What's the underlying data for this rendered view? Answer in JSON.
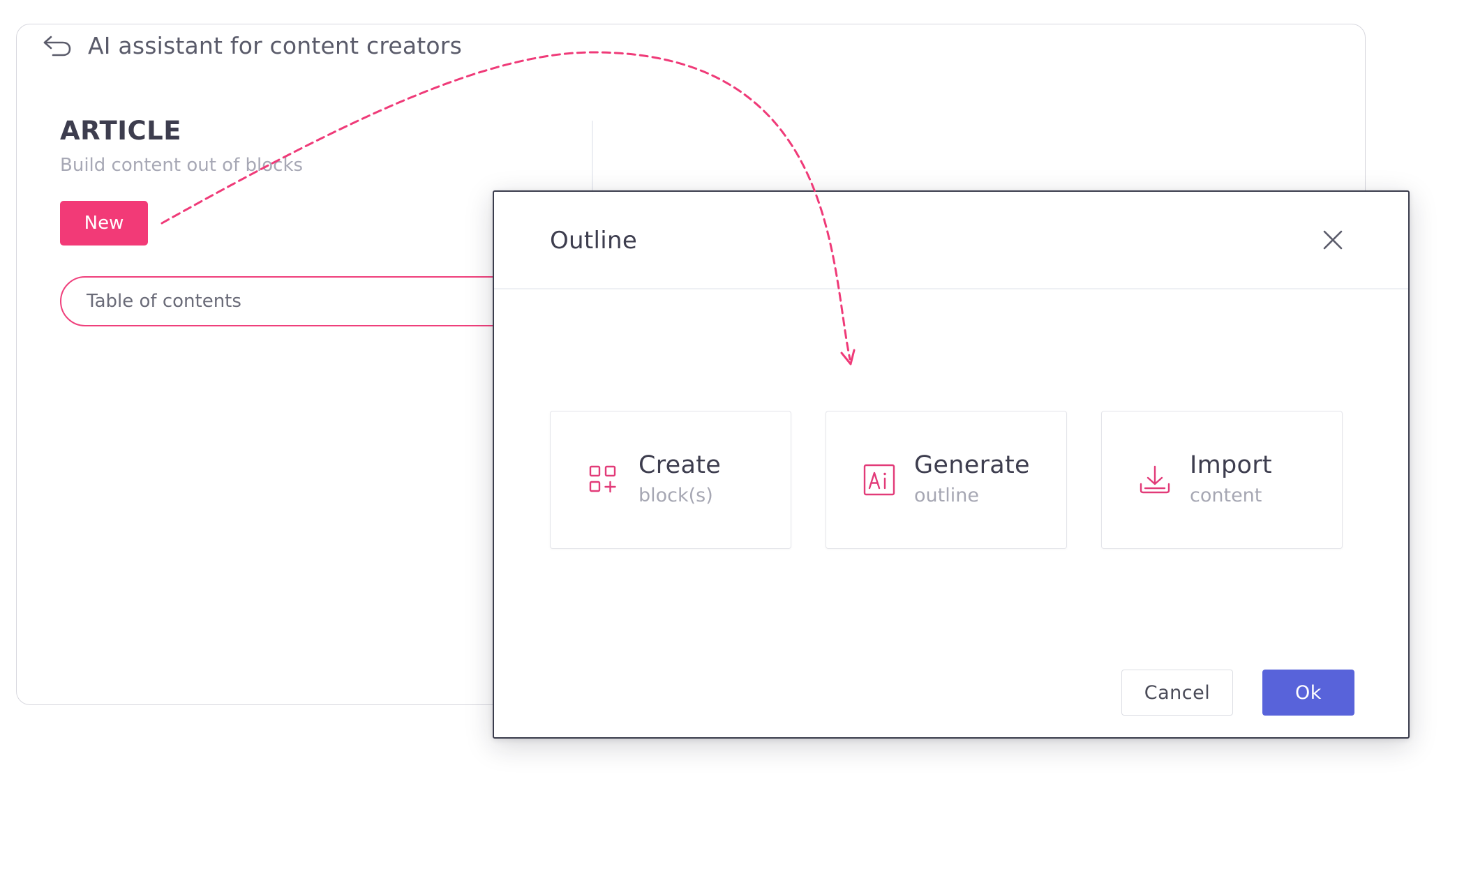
{
  "app": {
    "title": "AI assistant for content creators"
  },
  "icons": {
    "back": "back-arrow-icon",
    "close": "close-icon",
    "create": "grid-plus-icon",
    "generate": "ai-icon",
    "import": "download-tray-icon"
  },
  "colors": {
    "accent": "#f23a77",
    "primary": "#5863da"
  },
  "article": {
    "title": "ARTICLE",
    "subtitle": "Build content out of blocks",
    "new_label": "New",
    "toc_label": "Table of contents"
  },
  "modal": {
    "title": "Outline",
    "options": [
      {
        "title": "Create",
        "subtitle": "block(s)"
      },
      {
        "title": "Generate",
        "subtitle": "outline"
      },
      {
        "title": "Import",
        "subtitle": "content"
      }
    ],
    "cancel_label": "Cancel",
    "ok_label": "Ok"
  }
}
